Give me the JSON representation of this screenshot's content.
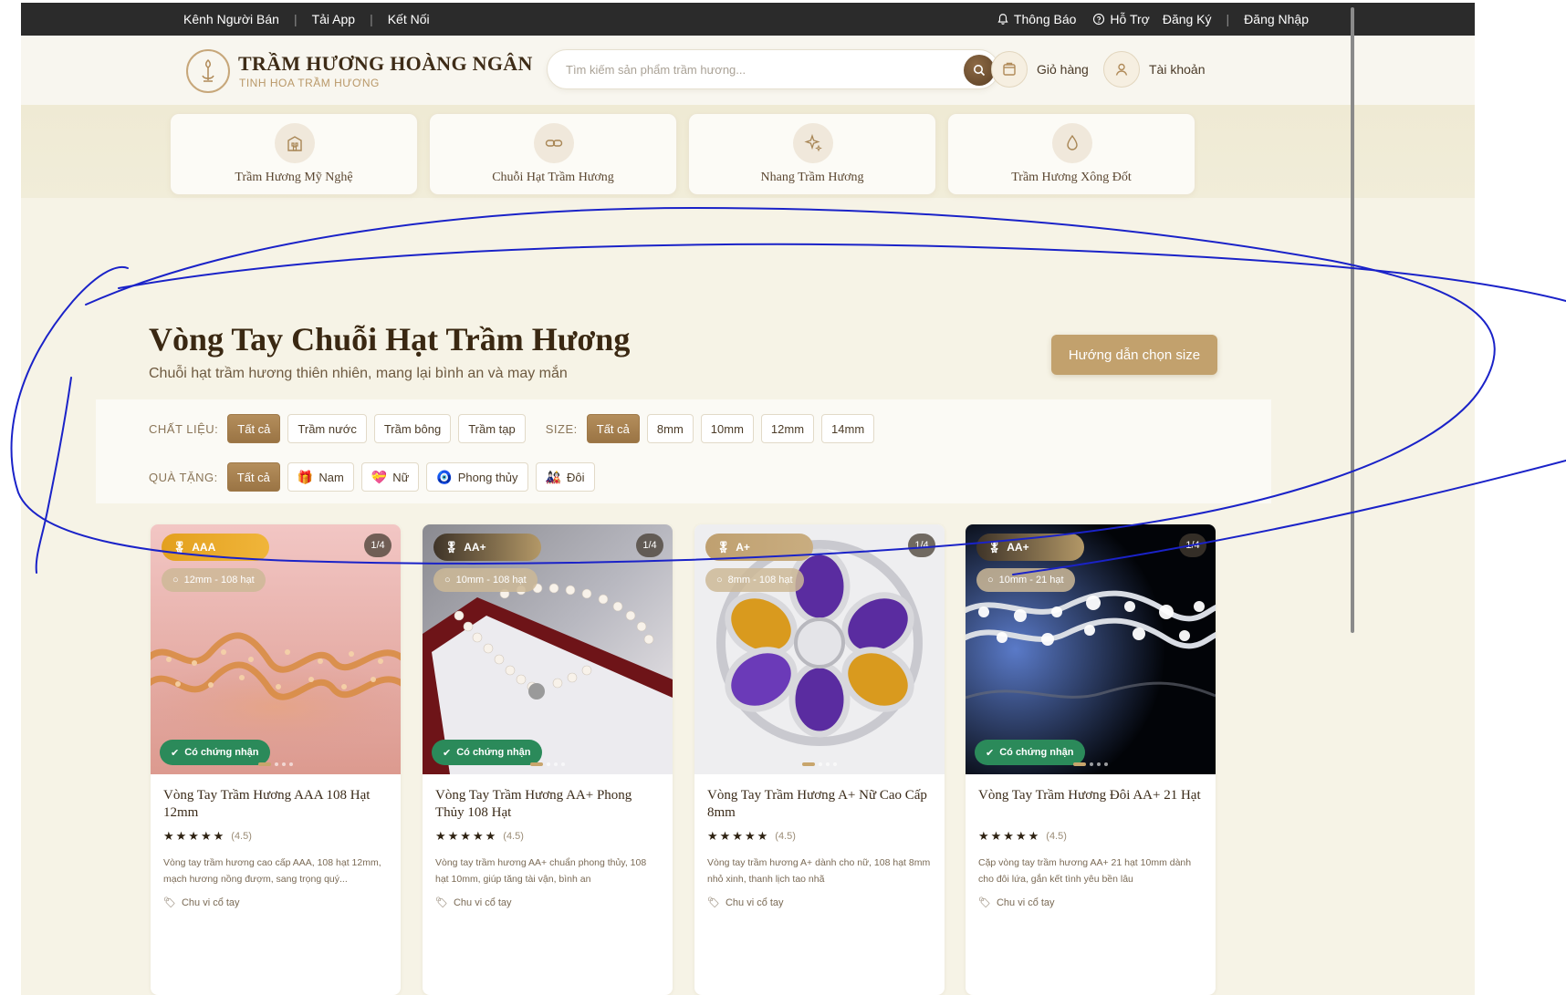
{
  "topbar": {
    "left_links": [
      "Kênh Người Bán",
      "Tải App",
      "Kết Nối"
    ],
    "notify": "Thông Báo",
    "support": "Hỗ Trợ",
    "register": "Đăng Ký",
    "login": "Đăng Nhập"
  },
  "header": {
    "brand": "TRẦM HƯƠNG HOÀNG NGÂN",
    "tagline": "TINH HOA TRẦM HƯƠNG",
    "search_placeholder": "Tìm kiếm sản phẩm trầm hương...",
    "cart": "Giỏ hàng",
    "account": "Tài khoản"
  },
  "categories": [
    {
      "label": "Trầm Hương Mỹ Nghệ",
      "icon": "building-icon"
    },
    {
      "label": "Chuỗi Hạt Trầm Hương",
      "icon": "link-icon"
    },
    {
      "label": "Nhang Trầm Hương",
      "icon": "sparkle-icon"
    },
    {
      "label": "Trầm Hương Xông Đốt",
      "icon": "drop-icon"
    }
  ],
  "hero": {
    "title": "Vòng Tay Chuỗi Hạt Trầm Hương",
    "subtitle": "Chuỗi hạt trầm hương thiên nhiên, mang lại bình an và may mắn",
    "size_guide": "Hướng dẫn chọn size"
  },
  "filters": {
    "material_label": "CHẤT LIỆU:",
    "materials": [
      "Tất cả",
      "Trầm nước",
      "Trầm bông",
      "Trầm tạp"
    ],
    "size_label": "SIZE:",
    "sizes": [
      "Tất cả",
      "8mm",
      "10mm",
      "12mm",
      "14mm"
    ],
    "gift_label": "QUÀ TẶNG:",
    "gifts": [
      "Tất cả",
      "Nam",
      "Nữ",
      "Phong thủy",
      "Đôi"
    ]
  },
  "products": [
    {
      "grade": "AAA",
      "counter": "1/4",
      "size": "12mm - 108 hạt",
      "cert": "Có chứng nhận",
      "name": "Vòng Tay Trầm Hương AAA 108 Hạt 12mm",
      "stars": "★★★★★",
      "rating": "(4.5)",
      "desc": "Vòng tay trầm hương cao cấp AAA, 108 hạt 12mm, mạch hương nồng đượm, sang trọng quý...",
      "tag": "Chu vi cổ tay"
    },
    {
      "grade": "AA+",
      "counter": "1/4",
      "size": "10mm - 108 hạt",
      "cert": "Có chứng nhận",
      "name": "Vòng Tay Trầm Hương AA+ Phong Thủy 108 Hạt",
      "stars": "★★★★★",
      "rating": "(4.5)",
      "desc": "Vòng tay trầm hương AA+ chuẩn phong thủy, 108 hạt 10mm, giúp tăng tài vận, bình an",
      "tag": "Chu vi cổ tay"
    },
    {
      "grade": "A+",
      "counter": "1/4",
      "size": "8mm - 108 hạt",
      "cert": "",
      "name": "Vòng Tay Trầm Hương A+ Nữ Cao Cấp 8mm",
      "stars": "★★★★★",
      "rating": "(4.5)",
      "desc": "Vòng tay trầm hương A+ dành cho nữ, 108 hạt 8mm nhỏ xinh, thanh lịch tao nhã",
      "tag": "Chu vi cổ tay"
    },
    {
      "grade": "AA+",
      "counter": "1/4",
      "size": "10mm - 21 hạt",
      "cert": "Có chứng nhận",
      "name": "Vòng Tay Trầm Hương Đôi AA+ 21 Hạt",
      "stars": "★★★★★",
      "rating": "(4.5)",
      "desc": "Cặp vòng tay trầm hương AA+ 21 hạt 10mm dành cho đôi lứa, gắn kết tình yêu bền lâu",
      "tag": "Chu vi cổ tay"
    }
  ],
  "colors": {
    "accent": "#c2a16d",
    "accent_dark": "#9a7444",
    "topbar": "#2b2b2b",
    "cert_green": "#2b8a5a",
    "annotation": "#1a22c8"
  }
}
